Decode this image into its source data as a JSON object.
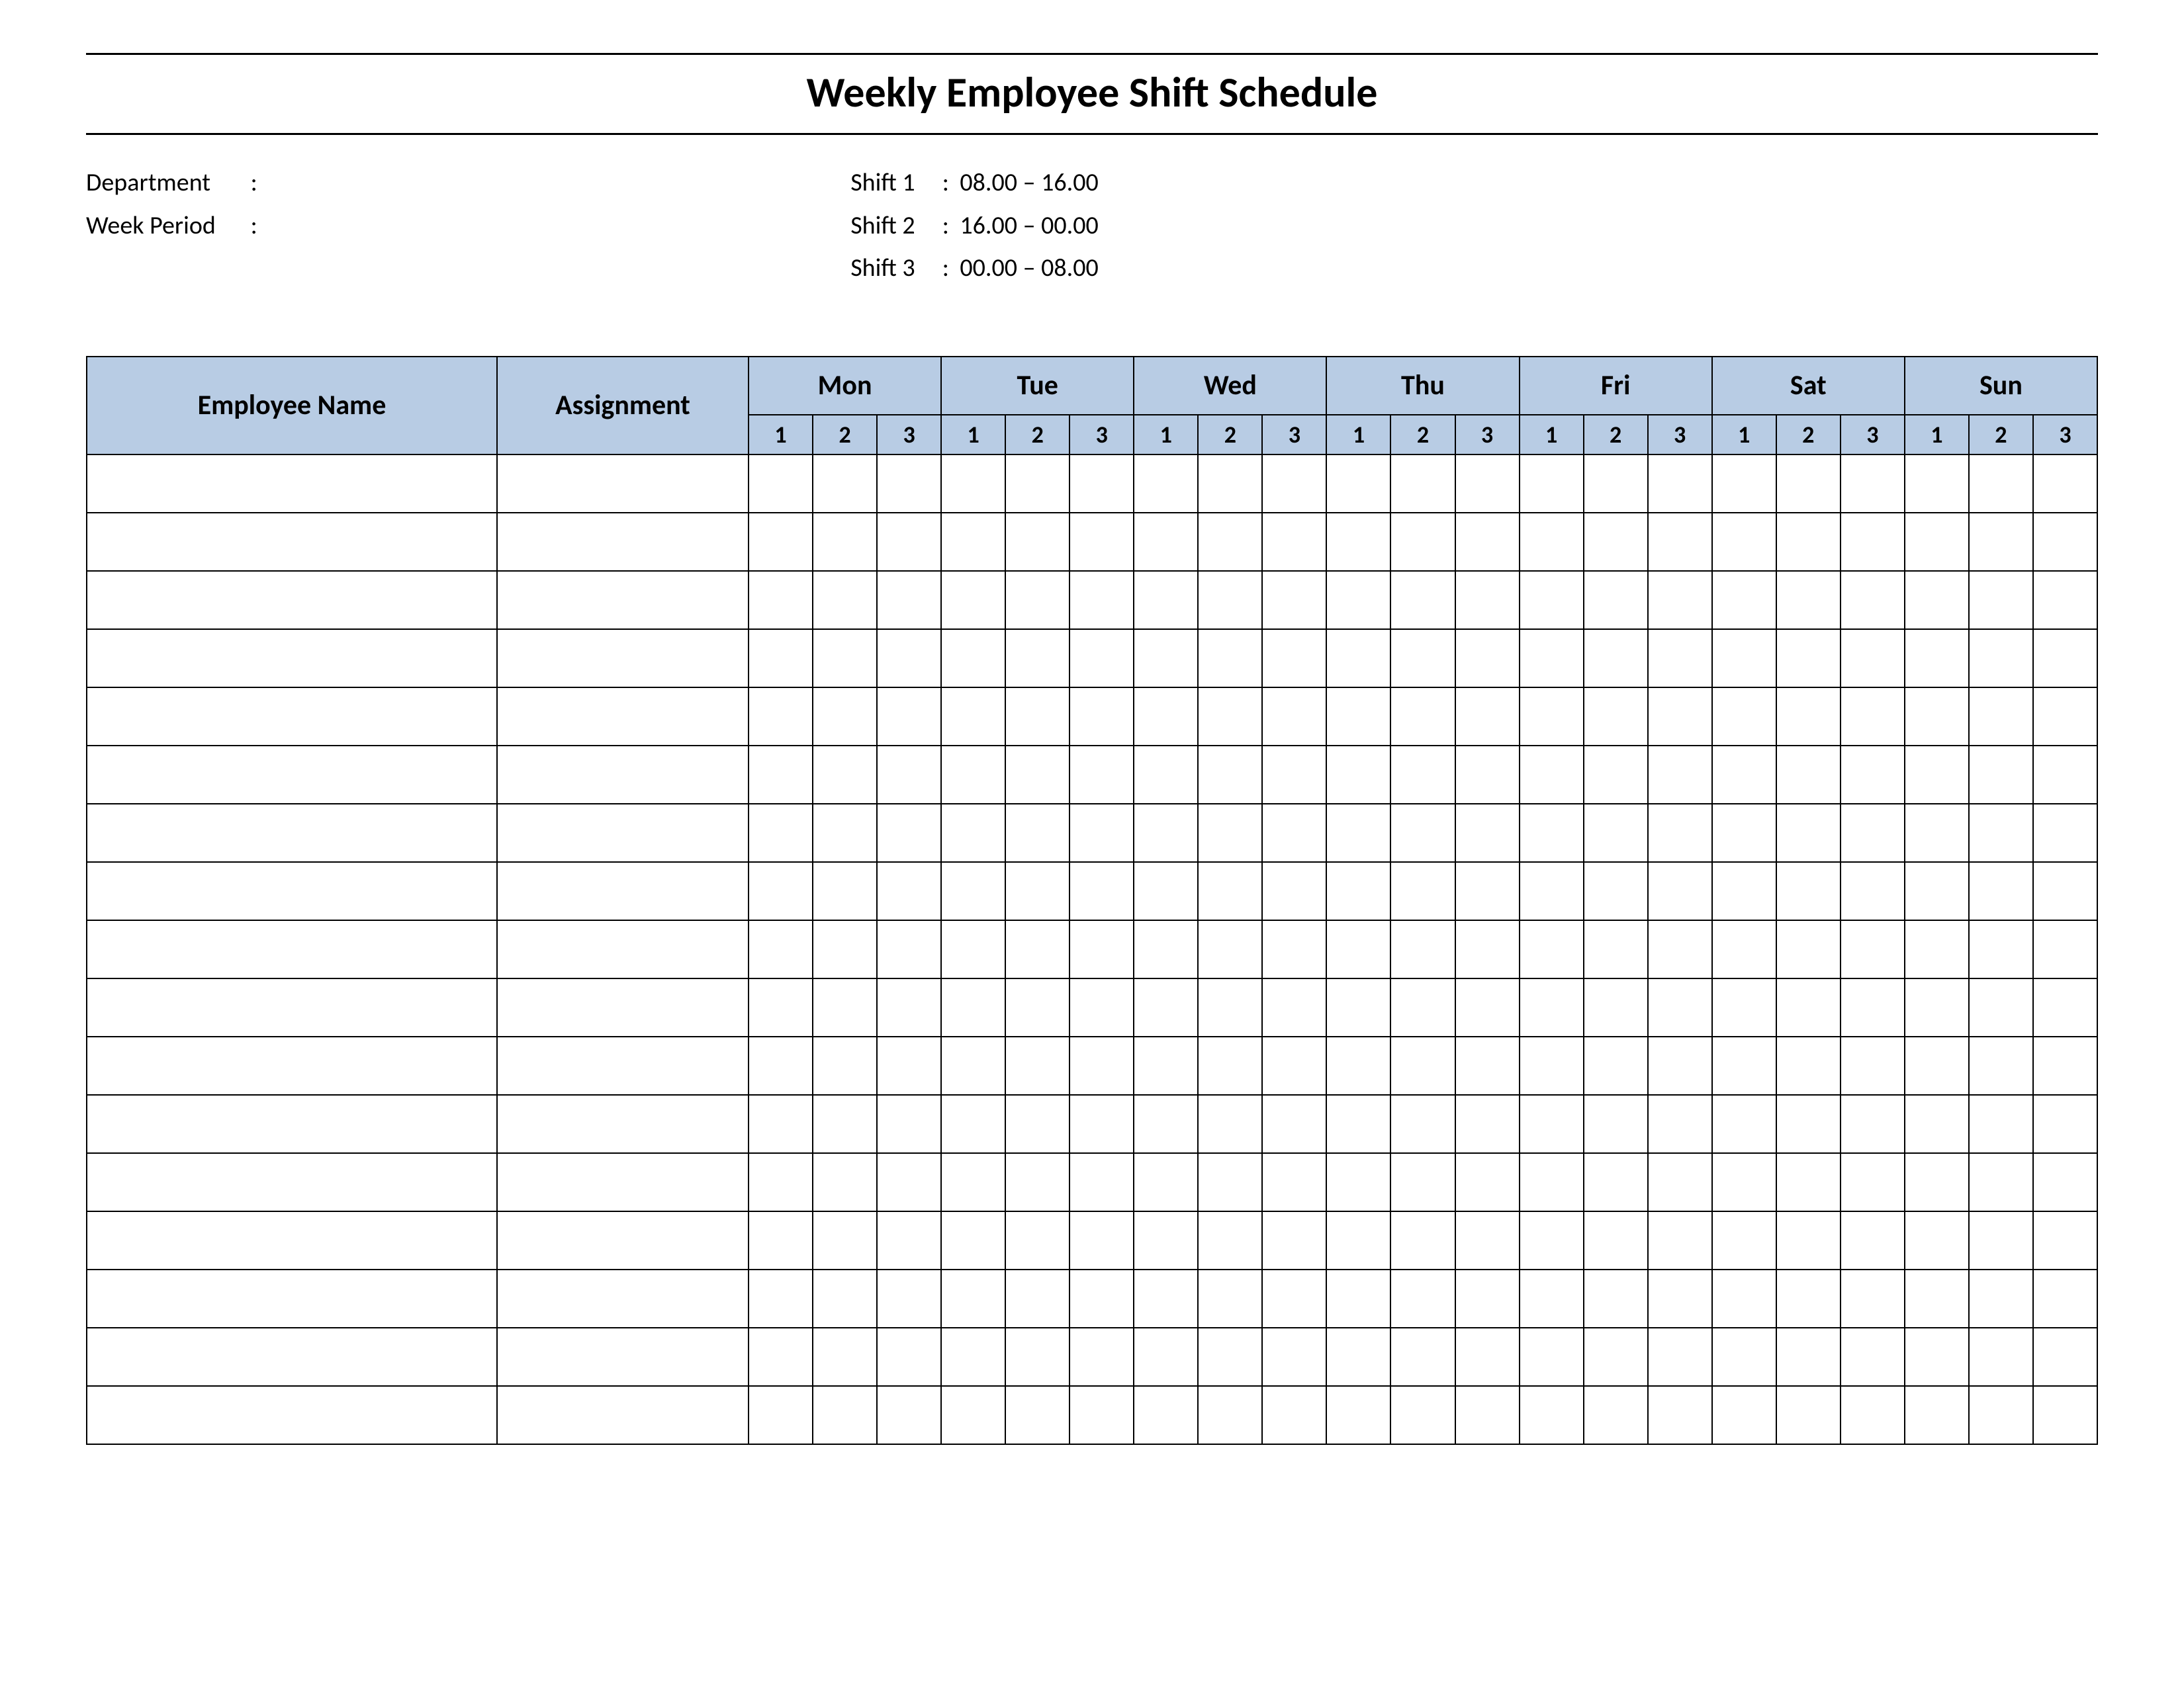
{
  "title": "Weekly Employee Shift Schedule",
  "meta": {
    "department_label": "Department",
    "department_colon": ":",
    "department_value": "",
    "week_period_label": "Week  Period",
    "week_period_colon": ":",
    "week_period_value": "",
    "shifts": [
      {
        "label": "Shift 1",
        "range": "08.00  –  16.00"
      },
      {
        "label": "Shift 2",
        "range": "16.00  –  00.00"
      },
      {
        "label": "Shift 3",
        "range": "00.00  –  08.00"
      }
    ]
  },
  "table": {
    "employee_name_header": "Employee Name",
    "assignment_header": "Assignment",
    "days": [
      "Mon",
      "Tue",
      "Wed",
      "Thu",
      "Fri",
      "Sat",
      "Sun"
    ],
    "sub_headers": [
      "1",
      "2",
      "3"
    ],
    "row_count": 17
  }
}
